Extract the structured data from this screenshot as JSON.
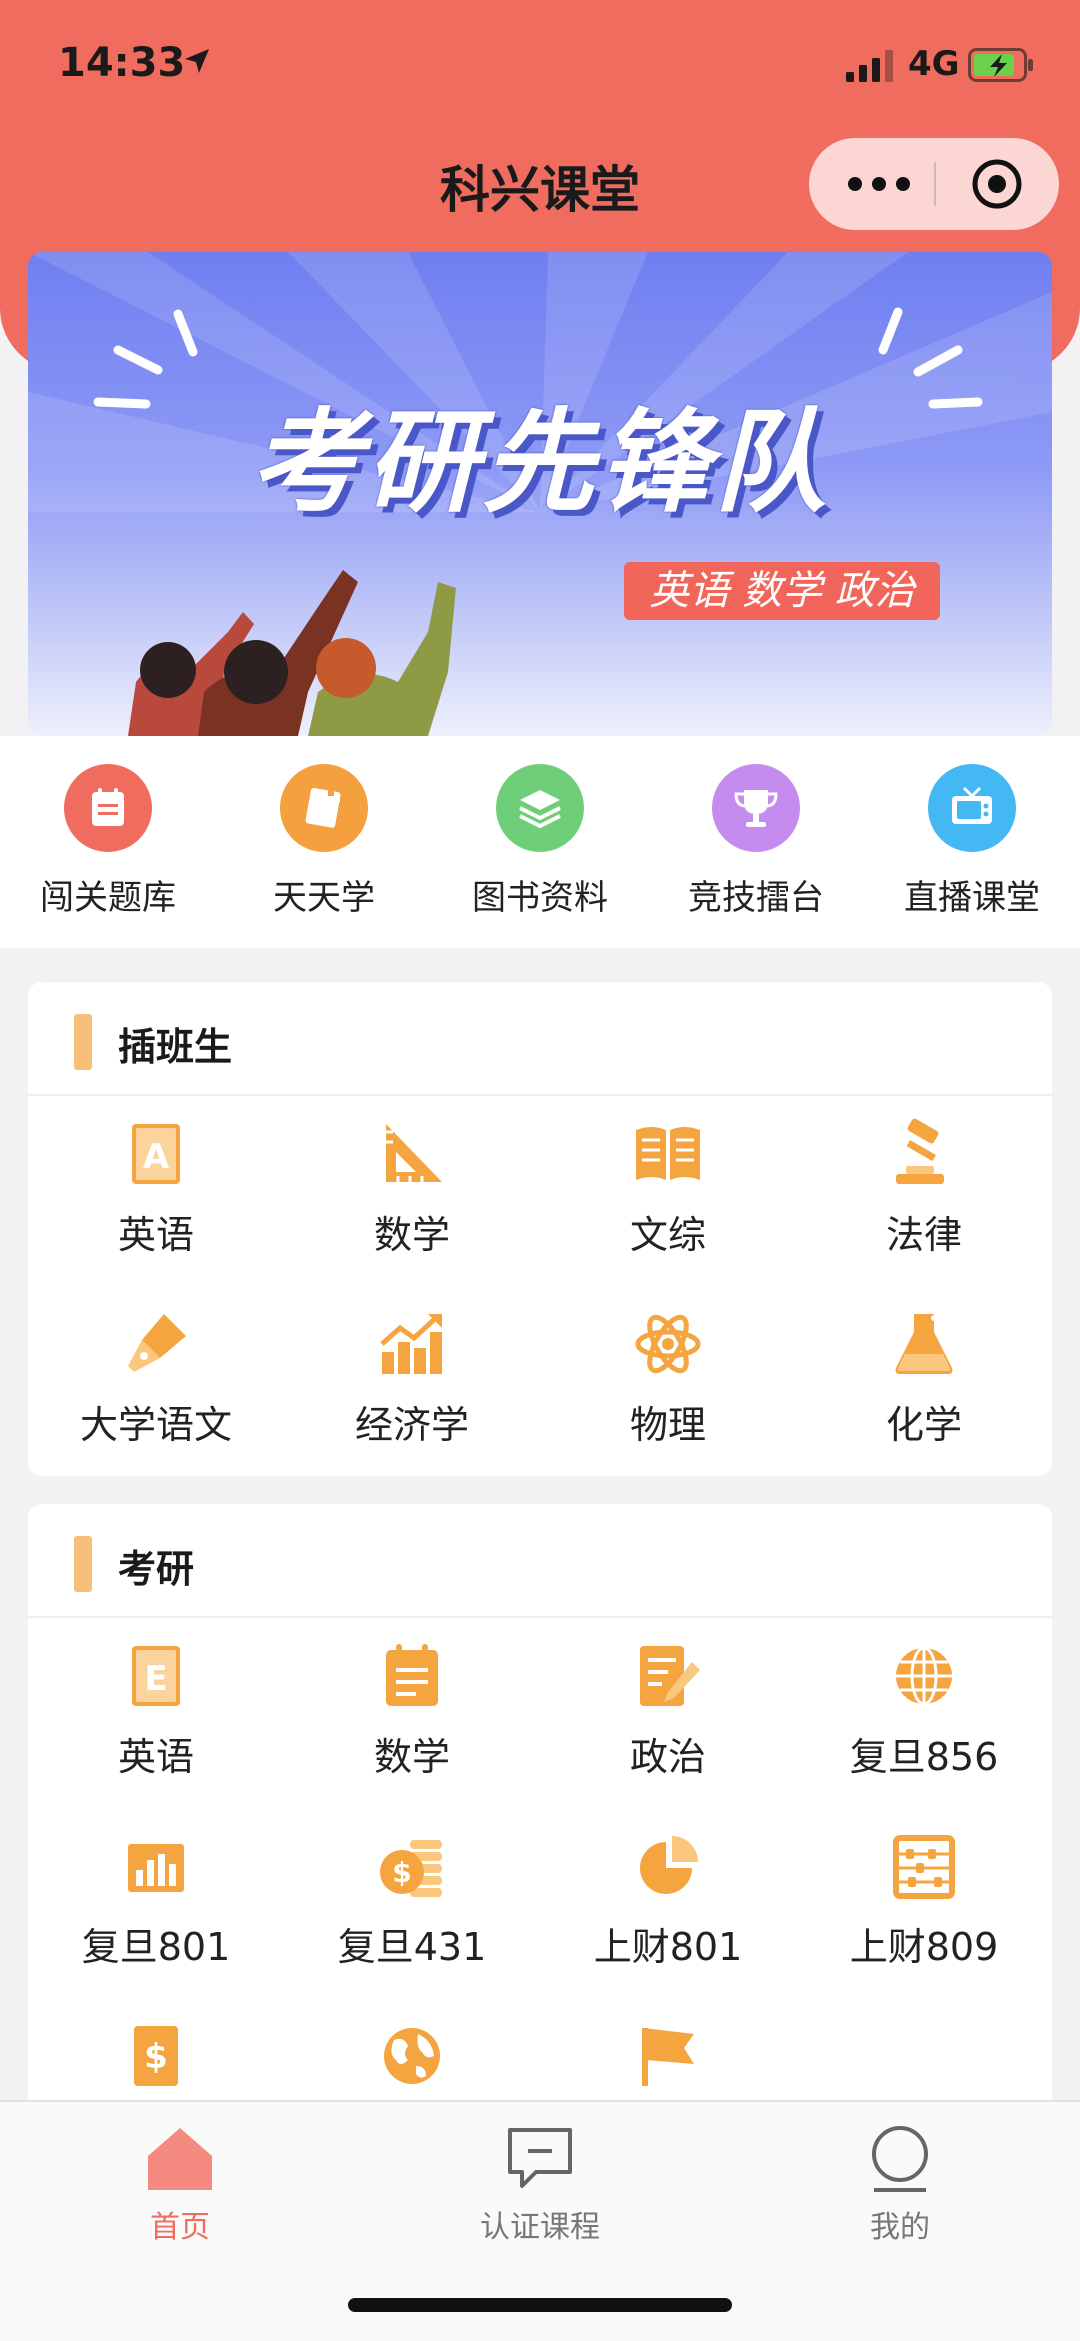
{
  "status_bar": {
    "time": "14:33",
    "network": "4G"
  },
  "header": {
    "title": "科兴课堂"
  },
  "banner": {
    "title": "考研先锋队",
    "tag": "英语 数学 政治"
  },
  "quick_menu": [
    {
      "label": "闯关题库",
      "icon": "question-bank-icon",
      "color": "#f06c5e"
    },
    {
      "label": "天天学",
      "icon": "daily-study-icon",
      "color": "#f5a03e"
    },
    {
      "label": "图书资料",
      "icon": "books-icon",
      "color": "#6fcf79"
    },
    {
      "label": "竞技擂台",
      "icon": "trophy-icon",
      "color": "#c58bee"
    },
    {
      "label": "直播课堂",
      "icon": "tv-icon",
      "color": "#44b8f2"
    }
  ],
  "sections": [
    {
      "title": "插班生",
      "items": [
        {
          "label": "英语",
          "icon": "english-book-icon"
        },
        {
          "label": "数学",
          "icon": "ruler-icon"
        },
        {
          "label": "文综",
          "icon": "open-book-icon"
        },
        {
          "label": "法律",
          "icon": "gavel-icon"
        },
        {
          "label": "大学语文",
          "icon": "pen-nib-icon"
        },
        {
          "label": "经济学",
          "icon": "growth-chart-icon"
        },
        {
          "label": "物理",
          "icon": "atom-icon"
        },
        {
          "label": "化学",
          "icon": "flask-icon"
        }
      ]
    },
    {
      "title": "考研",
      "items": [
        {
          "label": "英语",
          "icon": "e-book-icon"
        },
        {
          "label": "数学",
          "icon": "notepad-icon"
        },
        {
          "label": "政治",
          "icon": "document-edit-icon"
        },
        {
          "label": "复旦856",
          "icon": "globe-icon"
        },
        {
          "label": "复旦801",
          "icon": "bar-chart-icon"
        },
        {
          "label": "复旦431",
          "icon": "coins-icon"
        },
        {
          "label": "上财801",
          "icon": "pie-chart-icon"
        },
        {
          "label": "上财809",
          "icon": "abacus-icon"
        },
        {
          "label": "",
          "icon": "dollar-doc-icon"
        },
        {
          "label": "",
          "icon": "earth-icon"
        },
        {
          "label": "",
          "icon": "flag-icon"
        }
      ]
    }
  ],
  "tab_bar": [
    {
      "label": "首页",
      "icon": "home-icon",
      "active": true
    },
    {
      "label": "认证课程",
      "icon": "chat-icon",
      "active": false
    },
    {
      "label": "我的",
      "icon": "profile-icon",
      "active": false
    }
  ],
  "colors": {
    "header": "#f06c5e",
    "accent_orange": "#f5a53f",
    "active_tab": "#f06c5e"
  }
}
